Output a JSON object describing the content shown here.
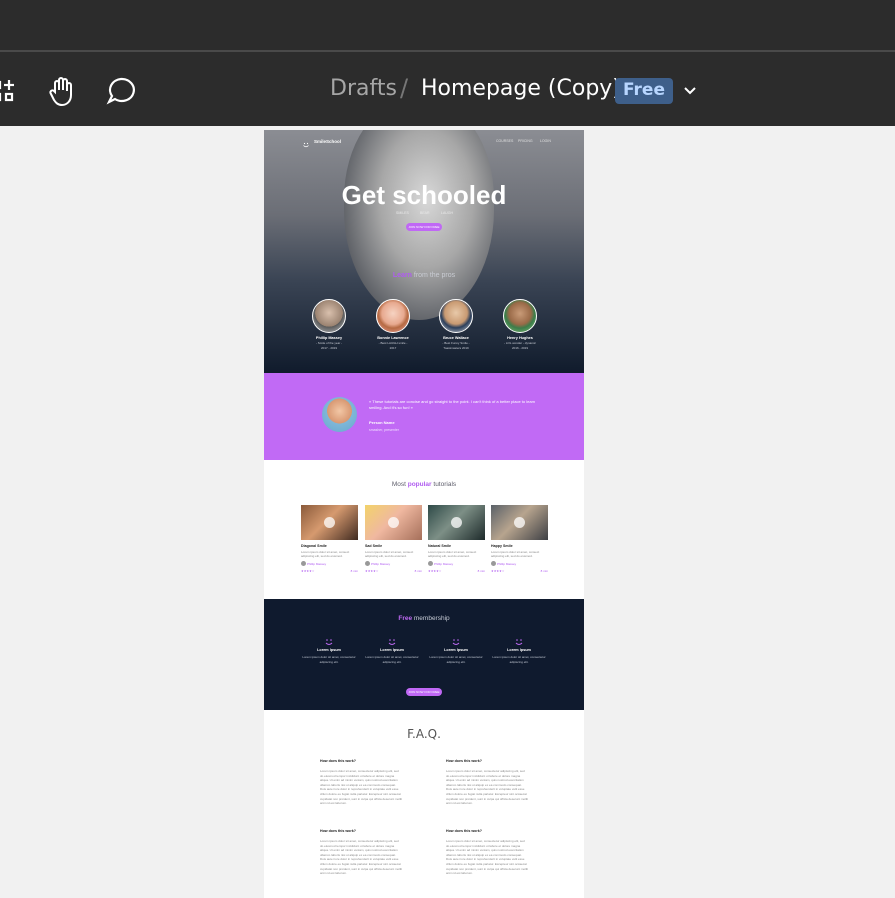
{
  "toolbar": {
    "breadcrumb_parent": "Drafts",
    "breadcrumb_separator": "/",
    "file_title": "Homepage (Copy)",
    "plan_badge": "Free",
    "icons": [
      "frame-tool-icon",
      "hand-tool-icon",
      "comment-tool-icon",
      "chevron-down-icon"
    ]
  },
  "site": {
    "logo": "SmileSchool",
    "nav": [
      "COURSES",
      "PRICING",
      "LOGIN"
    ],
    "hero_title": "Get schooled",
    "hero_sub": [
      "SMILES",
      "BEAR",
      "LAUGH"
    ],
    "hero_cta": "JOIN NOW FOR FREE",
    "learn_prefix": "Learn",
    "learn_rest": " from the pros",
    "instructors": [
      {
        "name": "Phillip Massey",
        "role": "- Smile of the year -",
        "years": "2017 - 2019"
      },
      {
        "name": "Bonnie Lawrence",
        "role": "- Best LAUGH smile -",
        "years": "2017"
      },
      {
        "name": "Bruce Wallace",
        "role": "- Best Funny Smile -",
        "years": "Toastmasters 2019"
      },
      {
        "name": "Henry Hughes",
        "role": "- LOL wonder - dynamic",
        "years": "2016 - 2019"
      }
    ],
    "testimonial": {
      "quote": "« These tutorials are concise and go straight to the point. I can't think of a better place to learn smiling. And it's so fun! »",
      "name": "Person Name",
      "role": "smasher, presenter"
    },
    "tutorials_prefix": "Most ",
    "tutorials_bold": "popular",
    "tutorials_suffix": " tutorials",
    "tutorials": [
      {
        "title": "Diagonal Smile",
        "desc": "Lorem ipsum dolor sit amet, consect adipiscing elit, sed do eiusmod.",
        "author": "Phillip Massey",
        "duration": "8 min"
      },
      {
        "title": "Sad Smile",
        "desc": "Lorem ipsum dolor sit amet, consect adipiscing elit, sed do eiusmod.",
        "author": "Phillip Massey",
        "duration": "8 min"
      },
      {
        "title": "Natural Smile",
        "desc": "Lorem ipsum dolor sit amet, consect adipiscing elit, sed do eiusmod.",
        "author": "Phillip Massey",
        "duration": "8 min"
      },
      {
        "title": "Happy Smile",
        "desc": "Lorem ipsum dolor sit amet, consect adipiscing elit, sed do eiusmod.",
        "author": "Phillip Massey",
        "duration": "8 min"
      }
    ],
    "membership_bold": "Free",
    "membership_rest": " membership",
    "features": [
      {
        "title": "Lorem Ipsum",
        "desc": "Lorem ipsum dolor sit amet, consectetur adipiscing elit."
      },
      {
        "title": "Lorem Ipsum",
        "desc": "Lorem ipsum dolor sit amet, consectetur adipiscing elit."
      },
      {
        "title": "Lorem Ipsum",
        "desc": "Lorem ipsum dolor sit amet, consectetur adipiscing elit."
      },
      {
        "title": "Lorem Ipsum",
        "desc": "Lorem ipsum dolor sit amet, consectetur adipiscing elit."
      }
    ],
    "membership_cta": "JOIN NOW FOR FREE",
    "faq_title": "F.A.Q.",
    "faq": [
      {
        "q": "How does this work?",
        "a": "Lorem ipsum dolor sit amet, consectetur adipiscing elit, sed do eiusmod tempor incididunt ut labore et dolore magna aliqua. Ut enim ad minim veniam, quis nostrud exercitation ullamco laboris nisi ut aliquip ex ea commodo consequat. Duis aute irure dolor in reprehenderit in voluptate velit esse cillum dolore eu fugiat nulla pariatur. Excepteur sint occaecat cupidatat non proident, sunt in culpa qui officia deserunt mollit anim id est laborum."
      },
      {
        "q": "How does this work?",
        "a": "Lorem ipsum dolor sit amet, consectetur adipiscing elit, sed do eiusmod tempor incididunt ut labore et dolore magna aliqua. Ut enim ad minim veniam, quis nostrud exercitation ullamco laboris nisi ut aliquip ex ea commodo consequat. Duis aute irure dolor in reprehenderit in voluptate velit esse cillum dolore eu fugiat nulla pariatur. Excepteur sint occaecat cupidatat non proident, sunt in culpa qui officia deserunt mollit anim id est laborum."
      },
      {
        "q": "How does this work?",
        "a": "Lorem ipsum dolor sit amet, consectetur adipiscing elit, sed do eiusmod tempor incididunt ut labore et dolore magna aliqua. Ut enim ad minim veniam, quis nostrud exercitation ullamco laboris nisi ut aliquip ex ea commodo consequat. Duis aute irure dolor in reprehenderit in voluptate velit esse cillum dolore eu fugiat nulla pariatur. Excepteur sint occaecat cupidatat non proident, sunt in culpa qui officia deserunt mollit anim id est laborum."
      },
      {
        "q": "How does this work?",
        "a": "Lorem ipsum dolor sit amet, consectetur adipiscing elit, sed do eiusmod tempor incididunt ut labore et dolore magna aliqua. Ut enim ad minim veniam, quis nostrud exercitation ullamco laboris nisi ut aliquip ex ea commodo consequat. Duis aute irure dolor in reprehenderit in voluptate velit esse cillum dolore eu fugiat nulla pariatur. Excepteur sint occaecat cupidatat non proident, sunt in culpa qui officia deserunt mollit anim id est laborum."
      }
    ]
  },
  "colors": {
    "accent": "#c068f5",
    "hero_dark": "#101b2c",
    "toolbar_bg": "#2c2c2c",
    "canvas_bg": "#f1f1f1",
    "badge_bg": "#3e5f8a"
  }
}
